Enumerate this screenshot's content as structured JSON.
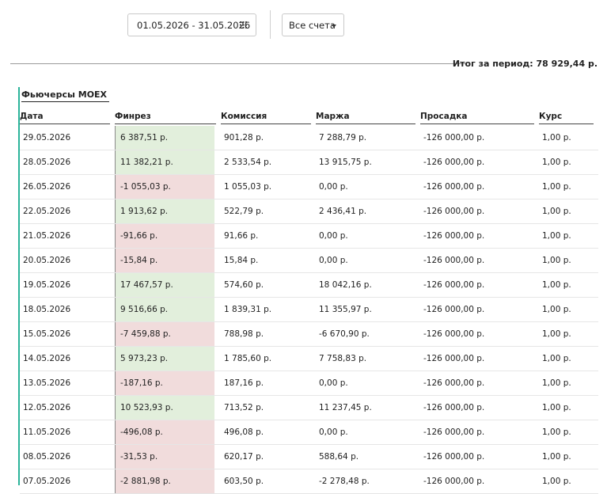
{
  "toolbar": {
    "date_range": "01.05.2026 - 31.05.2026",
    "accounts_select": "Все счета"
  },
  "summary": {
    "period_total": "Итог за период: 78 929,44 р."
  },
  "section": {
    "title": "Фьючерсы MOEX",
    "columns": [
      "Дата",
      "Финрез",
      "Комиссия",
      "Маржа",
      "Просадка",
      "Курс"
    ],
    "rows": [
      {
        "date": "29.05.2026",
        "pnl": "6 387,51 р.",
        "sign": "pos",
        "commission": "901,28 р.",
        "margin": "7 288,79 р.",
        "drawdown": "-126 000,00 р.",
        "rate": "1,00 р."
      },
      {
        "date": "28.05.2026",
        "pnl": "11 382,21 р.",
        "sign": "pos",
        "commission": "2 533,54 р.",
        "margin": "13 915,75 р.",
        "drawdown": "-126 000,00 р.",
        "rate": "1,00 р."
      },
      {
        "date": "26.05.2026",
        "pnl": "-1 055,03 р.",
        "sign": "neg",
        "commission": "1 055,03 р.",
        "margin": "0,00 р.",
        "drawdown": "-126 000,00 р.",
        "rate": "1,00 р."
      },
      {
        "date": "22.05.2026",
        "pnl": "1 913,62 р.",
        "sign": "pos",
        "commission": "522,79 р.",
        "margin": "2 436,41 р.",
        "drawdown": "-126 000,00 р.",
        "rate": "1,00 р."
      },
      {
        "date": "21.05.2026",
        "pnl": "-91,66 р.",
        "sign": "neg",
        "commission": "91,66 р.",
        "margin": "0,00 р.",
        "drawdown": "-126 000,00 р.",
        "rate": "1,00 р."
      },
      {
        "date": "20.05.2026",
        "pnl": "-15,84 р.",
        "sign": "neg",
        "commission": "15,84 р.",
        "margin": "0,00 р.",
        "drawdown": "-126 000,00 р.",
        "rate": "1,00 р."
      },
      {
        "date": "19.05.2026",
        "pnl": "17 467,57 р.",
        "sign": "pos",
        "commission": "574,60 р.",
        "margin": "18 042,16 р.",
        "drawdown": "-126 000,00 р.",
        "rate": "1,00 р."
      },
      {
        "date": "18.05.2026",
        "pnl": "9 516,66 р.",
        "sign": "pos",
        "commission": "1 839,31 р.",
        "margin": "11 355,97 р.",
        "drawdown": "-126 000,00 р.",
        "rate": "1,00 р."
      },
      {
        "date": "15.05.2026",
        "pnl": "-7 459,88 р.",
        "sign": "neg",
        "commission": "788,98 р.",
        "margin": "-6 670,90 р.",
        "drawdown": "-126 000,00 р.",
        "rate": "1,00 р."
      },
      {
        "date": "14.05.2026",
        "pnl": "5 973,23 р.",
        "sign": "pos",
        "commission": "1 785,60 р.",
        "margin": "7 758,83 р.",
        "drawdown": "-126 000,00 р.",
        "rate": "1,00 р."
      },
      {
        "date": "13.05.2026",
        "pnl": "-187,16 р.",
        "sign": "neg",
        "commission": "187,16 р.",
        "margin": "0,00 р.",
        "drawdown": "-126 000,00 р.",
        "rate": "1,00 р."
      },
      {
        "date": "12.05.2026",
        "pnl": "10 523,93 р.",
        "sign": "pos",
        "commission": "713,52 р.",
        "margin": "11 237,45 р.",
        "drawdown": "-126 000,00 р.",
        "rate": "1,00 р."
      },
      {
        "date": "11.05.2026",
        "pnl": "-496,08 р.",
        "sign": "neg",
        "commission": "496,08 р.",
        "margin": "0,00 р.",
        "drawdown": "-126 000,00 р.",
        "rate": "1,00 р."
      },
      {
        "date": "08.05.2026",
        "pnl": "-31,53 р.",
        "sign": "neg",
        "commission": "620,17 р.",
        "margin": "588,64 р.",
        "drawdown": "-126 000,00 р.",
        "rate": "1,00 р."
      },
      {
        "date": "07.05.2026",
        "pnl": "-2 881,98 р.",
        "sign": "neg",
        "commission": "603,50 р.",
        "margin": "-2 278,48 р.",
        "drawdown": "-126 000,00 р.",
        "rate": "1,00 р."
      }
    ]
  },
  "icons": {
    "calendar": "calendar-icon",
    "caret": "chevron-down-icon"
  },
  "colors": {
    "accent": "#2bb39a",
    "positive_bg": "#e2efdc",
    "negative_bg": "#f1dcdc"
  }
}
